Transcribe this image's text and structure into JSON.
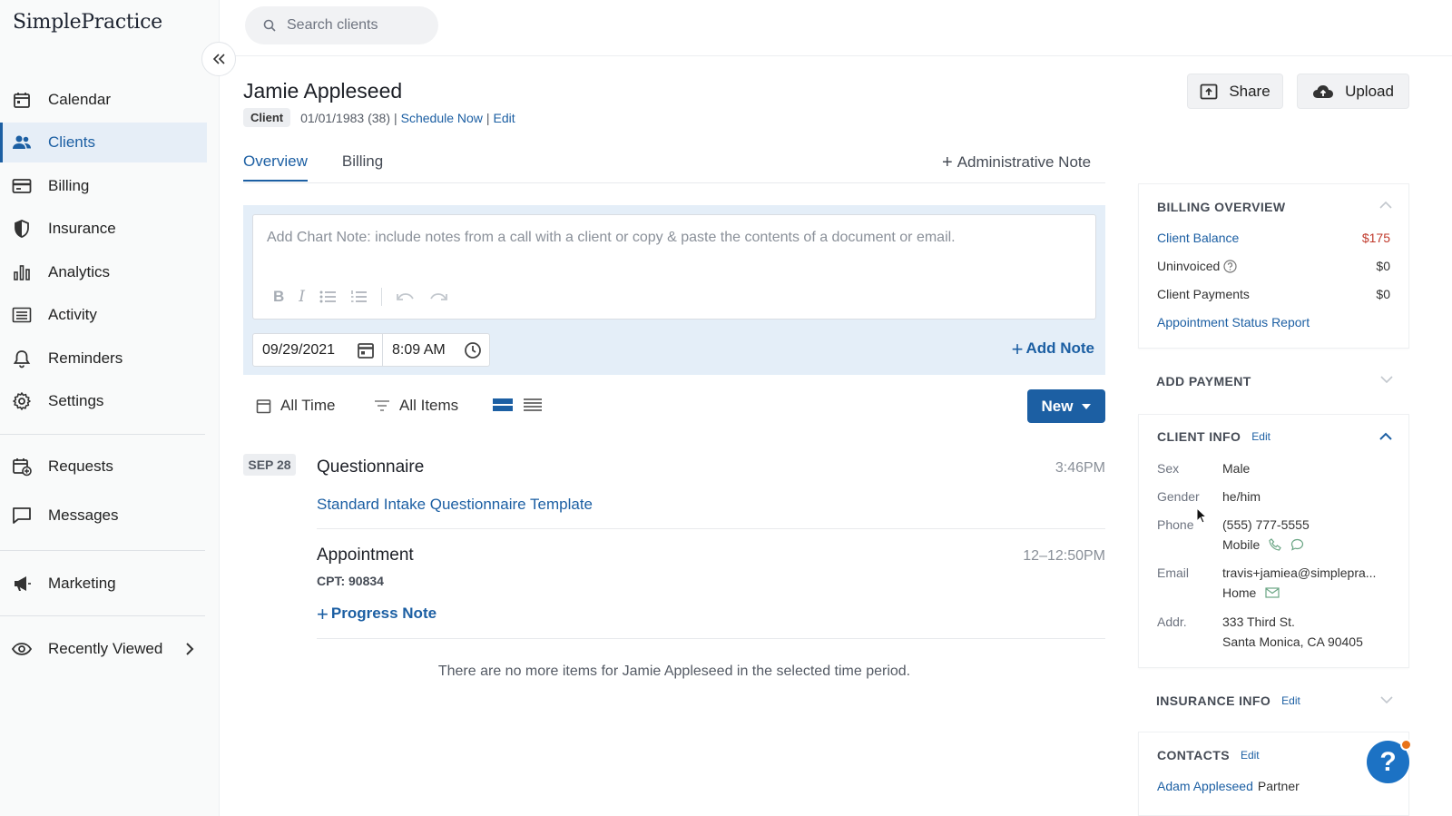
{
  "app": {
    "logo": "SimplePractice"
  },
  "sidebar": {
    "items": [
      {
        "label": "Calendar",
        "icon": "calendar-icon"
      },
      {
        "label": "Clients",
        "icon": "users-icon",
        "active": true
      },
      {
        "label": "Billing",
        "icon": "credit-card-icon"
      },
      {
        "label": "Insurance",
        "icon": "shield-icon"
      },
      {
        "label": "Analytics",
        "icon": "bar-chart-icon"
      },
      {
        "label": "Activity",
        "icon": "list-icon"
      },
      {
        "label": "Reminders",
        "icon": "bell-icon"
      },
      {
        "label": "Settings",
        "icon": "gear-icon"
      },
      {
        "label": "Requests",
        "icon": "calendar-plus-icon"
      },
      {
        "label": "Messages",
        "icon": "chat-icon"
      },
      {
        "label": "Marketing",
        "icon": "megaphone-icon"
      },
      {
        "label": "Recently Viewed",
        "icon": "eye-icon"
      }
    ]
  },
  "search": {
    "placeholder": "Search clients"
  },
  "client": {
    "name": "Jamie Appleseed",
    "badge": "Client",
    "dob": "01/01/1983 (38)",
    "schedule_link": "Schedule Now",
    "edit_link": "Edit",
    "separator": "|"
  },
  "actions": {
    "share": "Share",
    "upload": "Upload"
  },
  "tabs": [
    {
      "label": "Overview",
      "active": true
    },
    {
      "label": "Billing",
      "active": false
    }
  ],
  "admin_note": {
    "plus": "+",
    "label": "Administrative Note"
  },
  "chart_note": {
    "placeholder": "Add Chart Note: include notes from a call with a client or copy & paste the contents of a document or email.",
    "tools": {
      "bold": "B",
      "italic": "I"
    },
    "date": "09/29/2021",
    "time": "8:09 AM",
    "add_plus": "+",
    "add_label": "Add Note"
  },
  "filters": {
    "time": "All Time",
    "items": "All Items",
    "new_button": "New"
  },
  "timeline": {
    "date_chip": "SEP 28",
    "entries": [
      {
        "title": "Questionnaire",
        "time": "3:46PM",
        "link": "Standard Intake Questionnaire Template"
      },
      {
        "title": "Appointment",
        "time": "12–12:50PM",
        "cpt": "CPT: 90834",
        "plus": "+",
        "action": "Progress Note"
      }
    ],
    "end_message": "There are no more items for Jamie Appleseed in the selected time period."
  },
  "billing_overview": {
    "title": "BILLING OVERVIEW",
    "client_balance_label": "Client Balance",
    "client_balance": "$175",
    "uninvoiced_label": "Uninvoiced",
    "uninvoiced": "$0",
    "payments_label": "Client Payments",
    "payments": "$0",
    "report_link": "Appointment Status Report"
  },
  "add_payment": {
    "title": "ADD PAYMENT"
  },
  "client_info": {
    "title": "CLIENT INFO",
    "edit": "Edit",
    "sex_label": "Sex",
    "sex": "Male",
    "gender_label": "Gender",
    "gender": "he/him",
    "phone_label": "Phone",
    "phone": "(555) 777-5555",
    "phone_type": "Mobile",
    "email_label": "Email",
    "email": "travis+jamiea@simplepra...",
    "email_type": "Home",
    "addr_label": "Addr.",
    "addr_line1": "333 Third St.",
    "addr_line2": "Santa Monica, CA 90405"
  },
  "insurance_info": {
    "title": "INSURANCE INFO",
    "edit": "Edit"
  },
  "contacts": {
    "title": "CONTACTS",
    "edit": "Edit",
    "contact_name": "Adam Appleseed",
    "contact_relation": "Partner"
  },
  "help": {
    "label": "?"
  },
  "colors": {
    "accent": "#1c5fa3",
    "balance_red": "#c0392b",
    "help_blue": "#1c72c4",
    "notify_orange": "#e8731a"
  }
}
